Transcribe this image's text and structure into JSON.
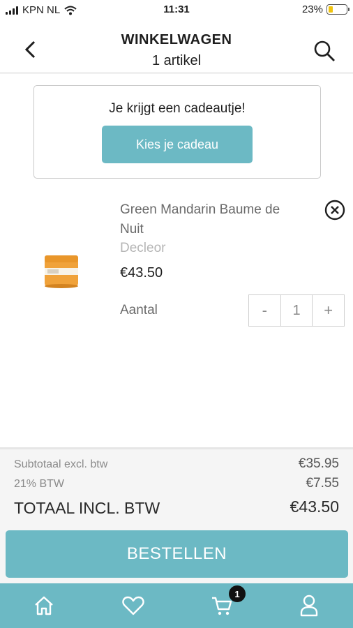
{
  "status_bar": {
    "carrier": "KPN NL",
    "time": "11:31",
    "battery": "23%",
    "battery_level": 0.23
  },
  "header": {
    "title": "WINKELWAGEN",
    "subtitle": "1 artikel",
    "back_icon": "chevron-left-icon",
    "search_icon": "search-icon"
  },
  "gift": {
    "message": "Je krijgt een cadeautje!",
    "button_label": "Kies je cadeau"
  },
  "product": {
    "name": "Green Mandarin Baume de Nuit",
    "brand": "Decleor",
    "price": "€43.50",
    "quantity_label": "Aantal",
    "quantity": "1",
    "minus": "-",
    "plus": "+"
  },
  "totals": {
    "subtotal_label": "Subtotaal excl. btw",
    "subtotal_value": "€35.95",
    "vat_label": "21% BTW",
    "vat_value": "€7.55",
    "total_label": "TOTAAL INCL. BTW",
    "total_value": "€43.50"
  },
  "order_button": "BESTELLEN",
  "tabbar": {
    "cart_badge": "1",
    "icons": [
      "home-icon",
      "heart-icon",
      "cart-icon",
      "user-icon"
    ]
  },
  "colors": {
    "accent": "#6cb9c4",
    "battery": "#f1c40f"
  }
}
